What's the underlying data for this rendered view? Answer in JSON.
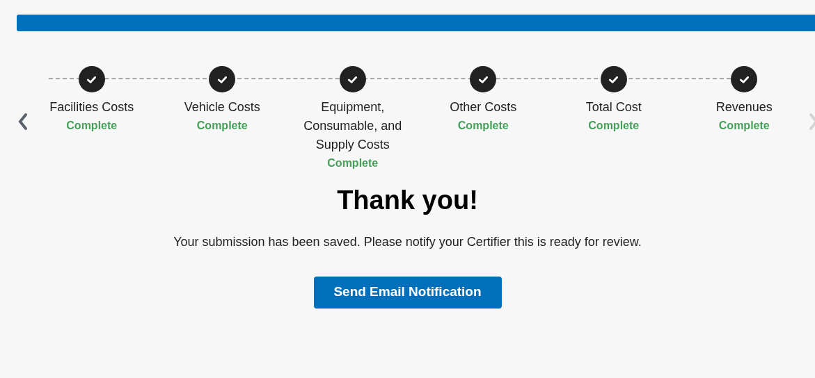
{
  "progress": {
    "level": 1
  },
  "carousel": {
    "prev_disabled": false,
    "next_disabled": true
  },
  "steps": [
    {
      "label": "Facilities Costs",
      "status": "Complete",
      "completed": true
    },
    {
      "label": "Vehicle Costs",
      "status": "Complete",
      "completed": true
    },
    {
      "label": "Equipment, Consumable, and Supply Costs",
      "status": "Complete",
      "completed": true
    },
    {
      "label": "Other Costs",
      "status": "Complete",
      "completed": true
    },
    {
      "label": "Total Cost",
      "status": "Complete",
      "completed": true
    },
    {
      "label": "Revenues",
      "status": "Complete",
      "completed": true
    }
  ],
  "heading": "Thank you!",
  "message": "Your submission has been saved. Please notify your Certifier this is ready for review.",
  "button": "Send Email Notification"
}
